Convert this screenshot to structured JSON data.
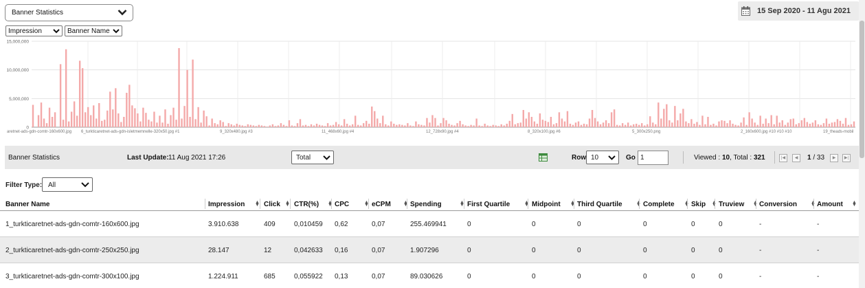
{
  "report_select": {
    "value": "Banner Statistics"
  },
  "date_range": {
    "label": "15 Sep 2020 - 11 Agu 2021"
  },
  "metric_select": {
    "value": "Impression"
  },
  "dimension_select": {
    "value": "Banner Name"
  },
  "chart_data": {
    "type": "bar",
    "ylim": [
      0,
      15000000
    ],
    "y_ticks": [
      "15,000,000",
      "10,000,000",
      "5,000,000",
      "0"
    ],
    "x_tick_labels": [
      "aretnet-ads-gdn-comtr-160x600.jpg",
      "6_turkticaretnet-ads-gdn-isletmemnelle-320x50.jpg #1",
      "9_320x480.jpg #3",
      "11_468x60.jpg #4",
      "12_728x90.jpg #4",
      "8_320x100.jpg #6",
      "5_300x250.png",
      "2_160x600.jpg #10 #10 #10",
      "19_theads-mobil"
    ],
    "color": "#f4a9a9",
    "values": [
      3900000,
      0,
      2100000,
      4300000,
      1500000,
      700000,
      3400000,
      1800000,
      2600000,
      0,
      11000000,
      1300000,
      13600000,
      1000000,
      2700000,
      4500000,
      2000000,
      11600000,
      10300000,
      2600000,
      3500000,
      2100000,
      3800000,
      1500000,
      4200000,
      1100000,
      1300000,
      2900000,
      6200000,
      3100000,
      6800000,
      2400000,
      900000,
      1800000,
      6000000,
      7400000,
      3800000,
      3300000,
      2400000,
      1000000,
      3400000,
      2500000,
      1300000,
      1000000,
      2700000,
      800000,
      2000000,
      800000,
      3100000,
      600000,
      2100000,
      3400000,
      1300000,
      13800000,
      1500000,
      3700000,
      10000000,
      1800000,
      11800000,
      1400000,
      3500000,
      800000,
      2900000,
      1900000,
      300000,
      1500000,
      700000,
      500000,
      1200000,
      900000,
      200000,
      700000,
      500000,
      300000,
      600000,
      400000,
      300000,
      200000,
      500000,
      400000,
      300000,
      200000,
      400000,
      300000,
      200000,
      100000,
      300000,
      500000,
      200000,
      300000,
      700000,
      400000,
      200000,
      1200000,
      300000,
      200000,
      700000,
      1400000,
      300000,
      400000,
      200000,
      500000,
      300000,
      600000,
      400000,
      300000,
      200000,
      700000,
      300000,
      400000,
      900000,
      500000,
      300000,
      1400000,
      600000,
      300000,
      500000,
      2000000,
      400000,
      300000,
      700000,
      1100000,
      600000,
      3600000,
      2800000,
      1500000,
      700000,
      2000000,
      500000,
      300000,
      1000000,
      600000,
      400000,
      500000,
      400000,
      300000,
      700000,
      300000,
      200000,
      1000000,
      500000,
      400000,
      300000,
      1600000,
      800000,
      2100000,
      1600000,
      300000,
      700000,
      1600000,
      1200000,
      600000,
      400000,
      300000,
      700000,
      1100000,
      500000,
      300000,
      200000,
      400000,
      300000,
      1500000,
      300000,
      200000,
      600000,
      300000,
      200000,
      400000,
      300000,
      200000,
      500000,
      300000,
      600000,
      1100000,
      2300000,
      500000,
      700000,
      800000,
      3000000,
      1500000,
      2600000,
      1800000,
      1000000,
      600000,
      2400000,
      1300000,
      1100000,
      900000,
      1800000,
      500000,
      700000,
      2600000,
      1500000,
      1000000,
      2800000,
      600000,
      400000,
      800000,
      1000000,
      400000,
      600000,
      500000,
      1500000,
      3000000,
      1600000,
      1000000,
      500000,
      800000,
      1200000,
      700000,
      2600000,
      3100000,
      400000,
      300000,
      700000,
      400000,
      800000,
      300000,
      500000,
      600000,
      400000,
      700000,
      300000,
      500000,
      1900000,
      800000,
      500000,
      4300000,
      1500000,
      3200000,
      4000000,
      1200000,
      800000,
      3700000,
      1200000,
      2400000,
      3200000,
      1000000,
      700000,
      1400000,
      600000,
      900000,
      400000,
      2000000,
      500000,
      1800000,
      400000,
      600000,
      300000,
      1000000,
      1200000,
      1100000,
      700000,
      1200000,
      600000,
      400000,
      300000,
      800000,
      1700000,
      400000,
      2600000,
      1500000,
      800000,
      400000,
      2000000,
      600000,
      1500000,
      700000,
      2100000,
      500000,
      2000000,
      800000,
      1200000,
      400000,
      800000,
      1400000,
      1500000,
      500000,
      700000,
      1200000,
      1600000,
      900000,
      600000,
      800000,
      1200000,
      500000,
      400000,
      700000,
      1500000,
      600000,
      800000,
      900000,
      1400000,
      1100000,
      600000,
      1600000,
      400000,
      500000,
      1000000
    ]
  },
  "table_toolbar": {
    "title": "Banner Statistics",
    "last_update_label": "Last Update:",
    "last_update_value": "11 Aug 2021 17:26",
    "total_select": "Total",
    "export_icon": "excel-icon",
    "row_label": "Row",
    "row_value": "10",
    "go_label": "Go",
    "go_value": "1",
    "viewed_label": "Viewed :",
    "viewed_value": "10",
    "total_label": ", Total :",
    "total_value": "321",
    "page_current": "1",
    "page_sep": "/",
    "page_total": "33"
  },
  "filter": {
    "label": "Filter Type:",
    "value": "All"
  },
  "table": {
    "columns": [
      "Banner Name",
      "Impression",
      "Click",
      "CTR(%)",
      "CPC",
      "eCPM",
      "Spending",
      "First Quartile",
      "Midpoint",
      "Third Quartile",
      "Complete",
      "Skip",
      "Truview",
      "Conversion",
      "Amount"
    ],
    "rows": [
      [
        "1_turkticaretnet-ads-gdn-comtr-160x600.jpg",
        "3.910.638",
        "409",
        "0,010459",
        "0,62",
        "0,07",
        "255.469941",
        "0",
        "0",
        "0",
        "0",
        "0",
        "0",
        "-",
        "-"
      ],
      [
        "2_turkticaretnet-ads-gdn-comtr-250x250.jpg",
        "28.147",
        "12",
        "0,042633",
        "0,16",
        "0,07",
        "1.907296",
        "0",
        "0",
        "0",
        "0",
        "0",
        "0",
        "-",
        "-"
      ],
      [
        "3_turkticaretnet-ads-gdn-comtr-300x100.jpg",
        "1.224.911",
        "685",
        "0,055922",
        "0,13",
        "0,07",
        "89.030626",
        "0",
        "0",
        "0",
        "0",
        "0",
        "0",
        "-",
        "-"
      ]
    ]
  }
}
